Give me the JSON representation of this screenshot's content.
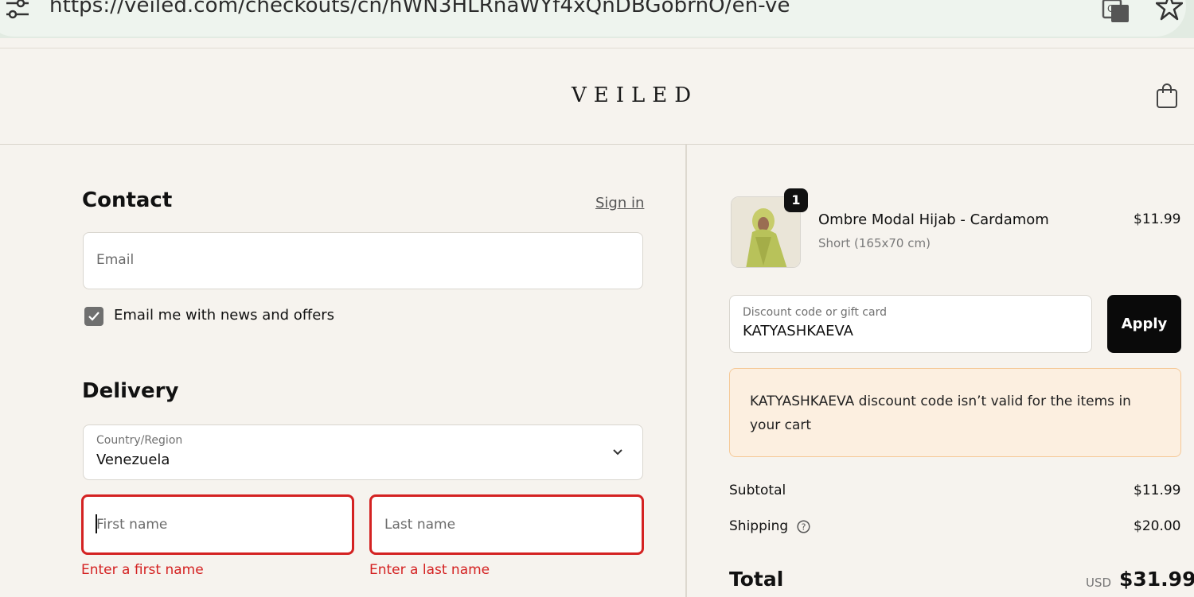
{
  "browser": {
    "url": "https://veiled.com/checkouts/cn/hWN3HLRnaWYf4xQnDBGobrnO/en-ve"
  },
  "header": {
    "logo": "VEILED"
  },
  "contact": {
    "heading": "Contact",
    "sign_in": "Sign in",
    "email_placeholder": "Email",
    "newsletter_label": "Email me with news and offers",
    "newsletter_checked": true
  },
  "delivery": {
    "heading": "Delivery",
    "country_label": "Country/Region",
    "country_value": "Venezuela",
    "first_name_placeholder": "First name",
    "last_name_placeholder": "Last name",
    "first_name_error": "Enter a first name",
    "last_name_error": "Enter a last name"
  },
  "cart": {
    "item": {
      "quantity": "1",
      "name": "Ombre Modal Hijab - Cardamom",
      "variant": "Short (165x70 cm)",
      "price": "$11.99"
    },
    "discount_label": "Discount code or gift card",
    "discount_value": "KATYASHKAEVA",
    "apply_label": "Apply",
    "warning_code": "KATYASHKAEVA",
    "warning_text": " discount code isn’t valid for the items in your cart",
    "subtotal_label": "Subtotal",
    "subtotal_value": "$11.99",
    "shipping_label": "Shipping",
    "shipping_value": "$20.00",
    "total_label": "Total",
    "total_currency": "USD",
    "total_value": "$31.99"
  },
  "colors": {
    "page_bg": "#f6f3ee",
    "error": "#d42222",
    "warning_bg": "#fcefe0",
    "button": "#0a0a0a"
  }
}
